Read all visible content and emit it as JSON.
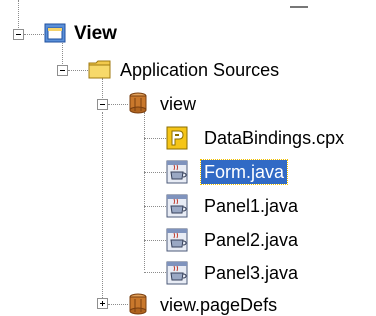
{
  "tree": {
    "root": {
      "label": "View",
      "expanded": true,
      "icon": "project-icon"
    },
    "app_sources": {
      "label": "Application Sources",
      "expanded": true,
      "icon": "folder-icon"
    },
    "view_pkg": {
      "label": "view",
      "expanded": true,
      "icon": "package-icon"
    },
    "files": [
      {
        "label": "DataBindings.cpx",
        "icon": "cpx-file-icon",
        "selected": false
      },
      {
        "label": "Form.java",
        "icon": "java-file-icon",
        "selected": true
      },
      {
        "label": "Panel1.java",
        "icon": "java-file-icon",
        "selected": false
      },
      {
        "label": "Panel2.java",
        "icon": "java-file-icon",
        "selected": false
      },
      {
        "label": "Panel3.java",
        "icon": "java-file-icon",
        "selected": false
      }
    ],
    "pagedefs_pkg": {
      "label": "view.pageDefs",
      "expanded": false,
      "icon": "package-icon"
    }
  },
  "colors": {
    "selection": "#316ac5",
    "folder": "#f2c94c",
    "package": "#b5651d"
  }
}
